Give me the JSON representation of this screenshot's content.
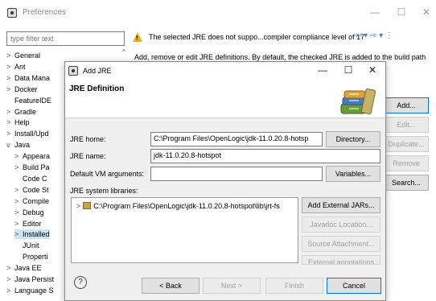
{
  "preferences": {
    "title": "Preferences",
    "filter_placeholder": "type filter text",
    "tree": [
      {
        "label": "General",
        "arrow": ">"
      },
      {
        "label": "Ant",
        "arrow": ">"
      },
      {
        "label": "Data Mana",
        "arrow": ">"
      },
      {
        "label": "Docker",
        "arrow": ">"
      },
      {
        "label": "FeatureIDE",
        "arrow": ""
      },
      {
        "label": "Gradle",
        "arrow": ">"
      },
      {
        "label": "Help",
        "arrow": ">"
      },
      {
        "label": "Install/Upd",
        "arrow": ">"
      },
      {
        "label": "Java",
        "arrow": "v"
      },
      {
        "label": "Appeara",
        "arrow": ">"
      },
      {
        "label": "Build Pa",
        "arrow": ">"
      },
      {
        "label": "Code C",
        "arrow": ""
      },
      {
        "label": "Code St",
        "arrow": ">"
      },
      {
        "label": "Compile",
        "arrow": ">"
      },
      {
        "label": "Debug",
        "arrow": ">"
      },
      {
        "label": "Editor",
        "arrow": ">"
      },
      {
        "label": "Installed",
        "arrow": ">"
      },
      {
        "label": "JUnit",
        "arrow": ""
      },
      {
        "label": "Properti",
        "arrow": ""
      },
      {
        "label": "Java EE",
        "arrow": ">"
      },
      {
        "label": "Java Persist",
        "arrow": ">"
      },
      {
        "label": "Language S",
        "arrow": ">"
      }
    ],
    "warning": "The selected JRE does not suppo...compiler compliance level of 17",
    "nav_glyphs": "⇦ ▾ ⇨ ▾ ⋮",
    "description": "Add, remove or edit JRE definitions. By default, the checked JRE is added to the build path",
    "side_buttons": [
      "Add...",
      "Edit...",
      "Duplicate...",
      "Remove",
      "Search..."
    ]
  },
  "dialog": {
    "title": "Add JRE",
    "header": "JRE Definition",
    "jre_home_label": "JRE home:",
    "jre_home_value": "C:\\Program Files\\OpenLogic\\jdk-11.0.20.8-hotsp",
    "jre_name_label": "JRE name:",
    "jre_name_value": "jdk-11.0.20.8-hotspot",
    "vm_args_label": "Default VM arguments:",
    "vm_args_value": "",
    "libs_label": "JRE system libraries:",
    "lib_entry": "C:\\Program Files\\OpenLogic\\jdk-11.0.20.8-hotspot\\lib\\jrt-fs",
    "directory_button": "Directory...",
    "variables_button": "Variables...",
    "lib_buttons": [
      "Add External JARs...",
      "Javadoc Location...",
      "Source Attachment...",
      "External annotations"
    ],
    "back_button": "< Back",
    "next_button": "Next >",
    "finish_button": "Finish",
    "cancel_button": "Cancel",
    "help_glyph": "?"
  }
}
